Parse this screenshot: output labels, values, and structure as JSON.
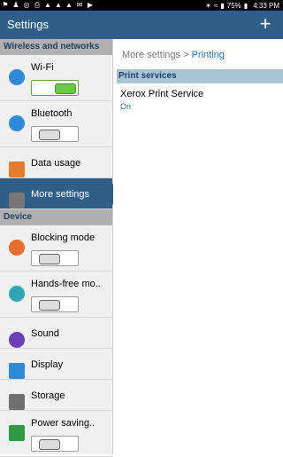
{
  "status": {
    "time": "4:33 PM",
    "battery": "75%",
    "icons": [
      "notification-icon",
      "wifi-icon",
      "signal-icon",
      "battery-icon"
    ]
  },
  "actionbar": {
    "title": "Settings",
    "add_label": "+"
  },
  "sidebar": {
    "section1": "Wireless and networks",
    "section2": "Device",
    "items": [
      {
        "label": "Wi-Fi"
      },
      {
        "label": "Bluetooth"
      },
      {
        "label": "Data usage"
      },
      {
        "label": "More settings"
      },
      {
        "label": "Blocking mode"
      },
      {
        "label": "Hands-free mo.."
      },
      {
        "label": "Sound"
      },
      {
        "label": "Display"
      },
      {
        "label": "Storage"
      },
      {
        "label": "Power saving.."
      }
    ]
  },
  "main": {
    "breadcrumb": {
      "parent": "More settings",
      "separator": ">",
      "current": "Printing"
    },
    "section_header": "Print services",
    "service": {
      "name": "Xerox Print Service",
      "status": "On"
    }
  },
  "colors": {
    "accent": "#2f5f88",
    "toggle_on": "#6fc54a",
    "link": "#2f77b3"
  }
}
